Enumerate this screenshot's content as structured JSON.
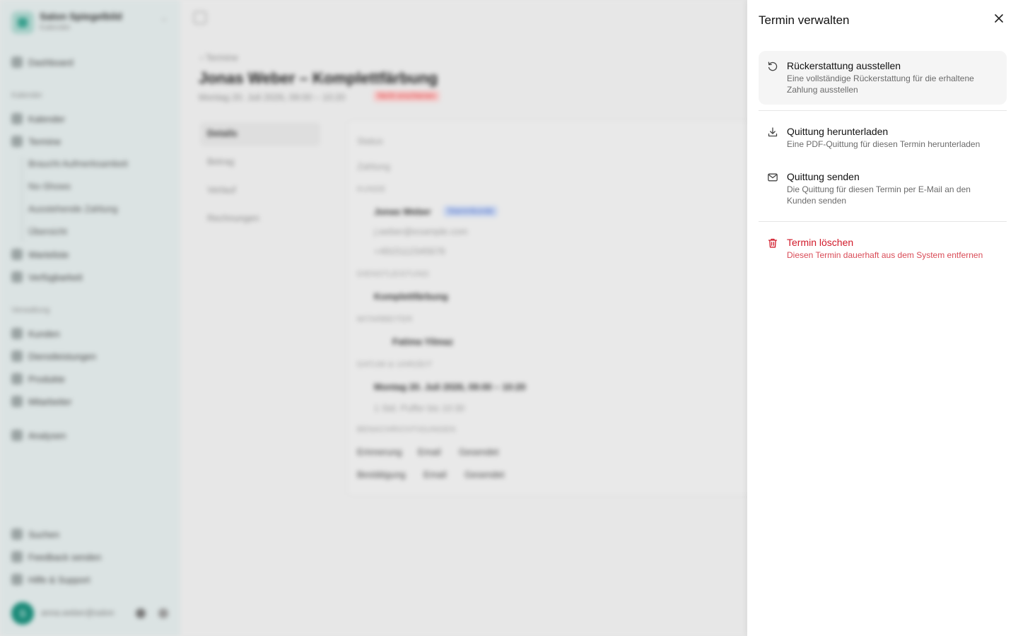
{
  "background": {
    "sidebar": {
      "org_name": "Salon Spiegelbild",
      "org_sub": "Kalender",
      "items": [
        {
          "label": "Dashboard"
        },
        {
          "label": "Kalender"
        },
        {
          "label": "Termine"
        },
        {
          "label": "Warteliste"
        },
        {
          "label": "Verfügbarkeit"
        },
        {
          "label": "Kunden"
        },
        {
          "label": "Dienstleistungen"
        },
        {
          "label": "Produkte"
        },
        {
          "label": "Mitarbeiter"
        },
        {
          "label": "Analysen"
        },
        {
          "label": "Suchen"
        },
        {
          "label": "Feedback senden"
        },
        {
          "label": "Hilfe & Support"
        }
      ],
      "sub_items": [
        {
          "label": "Braucht Aufmerksamkeit"
        },
        {
          "label": "No-Shows"
        },
        {
          "label": "Ausstehende Zahlung"
        },
        {
          "label": "Übersicht"
        }
      ],
      "groups": [
        "Kalender",
        "Verwaltung"
      ],
      "user_initial": "S",
      "user_name": "anna.weber@salon"
    },
    "main": {
      "back_label": "Termine",
      "title": "Jonas Weber – Komplettfärbung",
      "date": "Montag 20. Juli 2026, 09:00 – 10:20",
      "status_badge": "Nicht erschienen",
      "tabs": [
        "Details",
        "Betrag",
        "Verlauf",
        "Rechnungen"
      ],
      "fields": {
        "status": "Status",
        "zahlung": "Zahlung",
        "kunde_cap": "KUNDE",
        "kunde_name": "Jonas Weber",
        "kunde_pill": "Stammkunde",
        "email": "j.weber@example.com",
        "phone": "+4915112345678",
        "dienst_cap": "DIENSTLEISTUNG",
        "dienst": "Komplettfärbung",
        "mitarbeiter_cap": "MITARBEITER",
        "mitarbeiter": "Fatima Yilmaz",
        "datum_cap": "DATUM & UHRZEIT",
        "datum": "Montag 20. Juli 2026, 09:00 – 10:20",
        "dauer": "1 Std. Puffer bis 10:30",
        "benachr_cap": "BENACHRICHTIGUNGEN",
        "n1": [
          "Erinnerung",
          "Email",
          "Gesendet"
        ],
        "n2": [
          "Bestätigung",
          "Email",
          "Gesendet"
        ]
      }
    }
  },
  "drawer": {
    "title": "Termin verwalten",
    "options": [
      {
        "label": "Rückerstattung ausstellen",
        "description": "Eine vollständige Rückerstattung für die erhaltene Zahlung ausstellen",
        "icon": "refund-icon"
      },
      {
        "label": "Quittung herunterladen",
        "description": "Eine PDF-Quittung für diesen Termin herunterladen",
        "icon": "download-icon"
      },
      {
        "label": "Quittung senden",
        "description": "Die Quittung für diesen Termin per E-Mail an den Kunden senden",
        "icon": "mail-icon"
      },
      {
        "label": "Termin löschen",
        "description": "Diesen Termin dauerhaft aus dem System entfernen",
        "icon": "trash-icon"
      }
    ]
  },
  "colors": {
    "danger": "#d11a2a",
    "accent": "#1a8a78"
  }
}
